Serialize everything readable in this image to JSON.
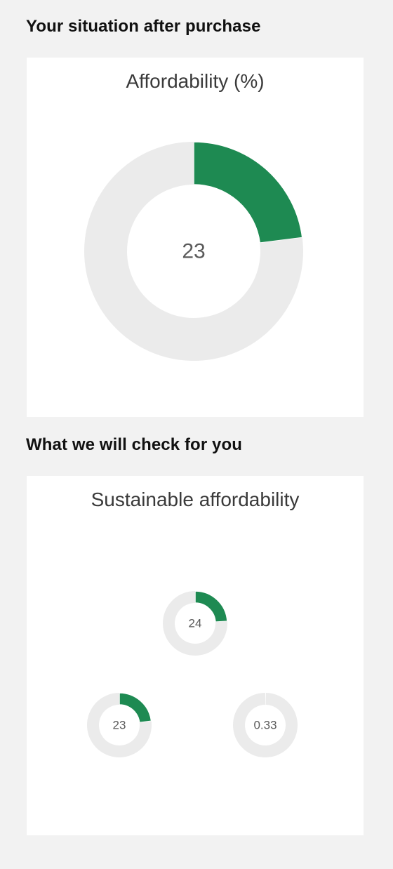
{
  "sections": {
    "situation_heading": "Your situation after purchase",
    "check_heading": "What we will check for you"
  },
  "colors": {
    "accent": "#1e8a52",
    "track": "#ebebeb",
    "background": "#f2f2f2",
    "card": "#ffffff"
  },
  "chart_data": [
    {
      "type": "pie",
      "title": "Affordability (%)",
      "center_label": "23",
      "values": [
        23,
        77
      ]
    },
    {
      "type": "pie",
      "title": "Sustainable affordability",
      "gauges": [
        {
          "center_label": "24",
          "values": [
            24,
            76
          ]
        },
        {
          "center_label": "23",
          "values": [
            23,
            77
          ]
        },
        {
          "center_label": "0.33",
          "values": [
            0.33,
            99.67
          ]
        }
      ]
    }
  ]
}
